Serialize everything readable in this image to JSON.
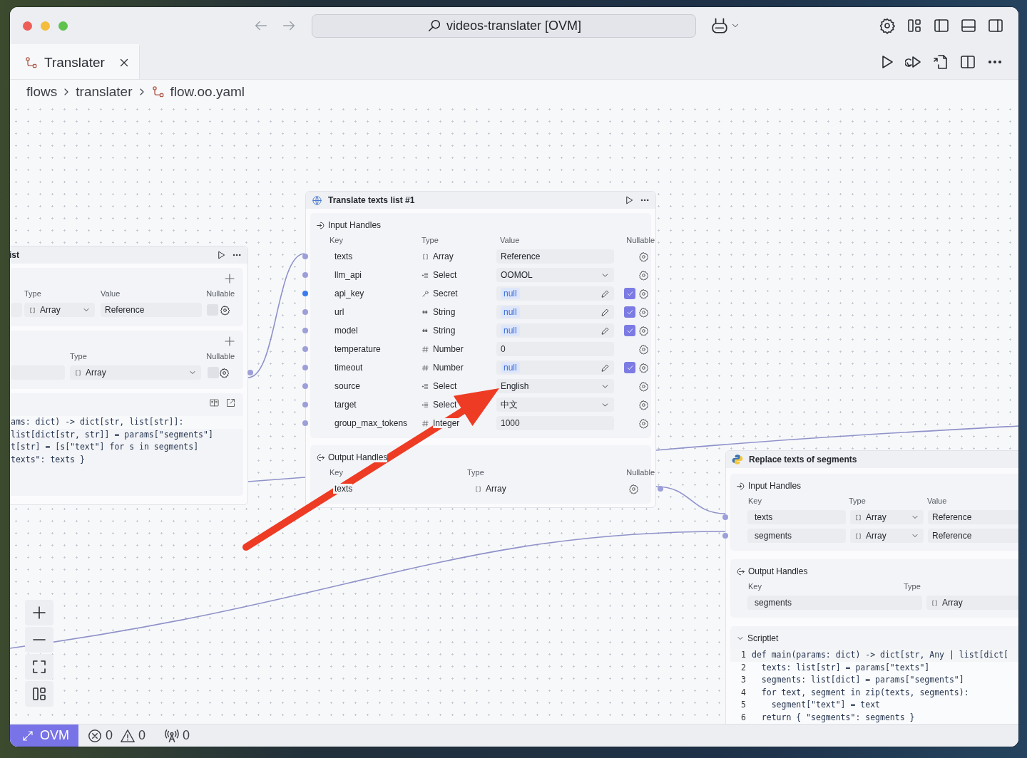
{
  "titlebar": {
    "search": "videos-translater [OVM]"
  },
  "tabs": [
    {
      "label": "Translater",
      "selected": true
    }
  ],
  "breadcrumb": [
    "flows",
    "translater",
    "flow.oo.yaml"
  ],
  "left_node": {
    "title": "ist",
    "input_columns": [
      "Type",
      "Value",
      "Nullable"
    ],
    "inputs": [
      {
        "type": "Array",
        "value": "Reference",
        "nullable": false
      }
    ],
    "output_columns": [
      "Type",
      "Nullable"
    ],
    "outputs": [
      {
        "type": "Array",
        "nullable": false
      }
    ],
    "code_lines": [
      "ams: dict) -> dict[str, list[str]]:",
      "list[dict[str, str]] = params[\"segments\"]",
      "t[str] = [s[\"text\"] for s in segments]",
      "texts\": texts }"
    ]
  },
  "middle_node": {
    "title": "Translate texts list #1",
    "inputs_title": "Input Handles",
    "input_columns": [
      "Key",
      "Type",
      "Value",
      "Nullable"
    ],
    "inputs": [
      {
        "key": "texts",
        "type": {
          "kind": "array",
          "label": "Array"
        },
        "kind": "text",
        "value": "Reference",
        "nullable": false,
        "handle_active": false
      },
      {
        "key": "llm_api",
        "type": {
          "kind": "select",
          "label": "Select"
        },
        "kind": "select",
        "value": "OOMOL",
        "nullable": false,
        "handle_active": false
      },
      {
        "key": "api_key",
        "type": {
          "kind": "secret",
          "label": "Secret"
        },
        "kind": "null",
        "value": "null",
        "nullable": true,
        "handle_active": true
      },
      {
        "key": "url",
        "type": {
          "kind": "string",
          "label": "String"
        },
        "kind": "null",
        "value": "null",
        "nullable": true,
        "handle_active": false
      },
      {
        "key": "model",
        "type": {
          "kind": "string",
          "label": "String"
        },
        "kind": "null",
        "value": "null",
        "nullable": true,
        "handle_active": false
      },
      {
        "key": "temperature",
        "type": {
          "kind": "number",
          "label": "Number"
        },
        "kind": "text",
        "value": "0",
        "nullable": false,
        "handle_active": false
      },
      {
        "key": "timeout",
        "type": {
          "kind": "number",
          "label": "Number"
        },
        "kind": "null",
        "value": "null",
        "nullable": true,
        "handle_active": false
      },
      {
        "key": "source",
        "type": {
          "kind": "select",
          "label": "Select"
        },
        "kind": "select",
        "value": "English",
        "nullable": false,
        "handle_active": false
      },
      {
        "key": "target",
        "type": {
          "kind": "select",
          "label": "Select"
        },
        "kind": "select",
        "value": "中文",
        "nullable": false,
        "handle_active": false
      },
      {
        "key": "group_max_tokens",
        "type": {
          "kind": "number",
          "label": "Integer"
        },
        "kind": "text",
        "value": "1000",
        "nullable": false,
        "handle_active": false
      }
    ],
    "outputs_title": "Output Handles",
    "output_columns": [
      "Key",
      "Type",
      "Nullable"
    ],
    "outputs": [
      {
        "key": "texts",
        "type": {
          "kind": "array",
          "label": "Array"
        },
        "nullable": false
      }
    ]
  },
  "right_node": {
    "title": "Replace texts of segments",
    "inputs_title": "Input Handles",
    "input_columns": [
      "Key",
      "Type",
      "Value"
    ],
    "inputs": [
      {
        "key": "texts",
        "type": "Array",
        "value": "Reference"
      },
      {
        "key": "segments",
        "type": "Array",
        "value": "Reference"
      }
    ],
    "outputs_title": "Output Handles",
    "output_columns": [
      "Key",
      "Type"
    ],
    "outputs": [
      {
        "key": "segments",
        "type": "Array"
      }
    ],
    "scriptlet": {
      "title": "Scriptlet",
      "expanded": true,
      "lines": [
        {
          "number": "1",
          "code": "def main(params: dict) -> dict[str, Any | list[dict["
        },
        {
          "number": "2",
          "code": "  texts: list[str] = params[\"texts\"]"
        },
        {
          "number": "3",
          "code": "  segments: list[dict] = params[\"segments\"]"
        },
        {
          "number": "4",
          "code": "  for text, segment in zip(texts, segments):"
        },
        {
          "number": "5",
          "code": "    segment[\"text\"] = text"
        },
        {
          "number": "6",
          "code": "  return { \"segments\": segments }"
        }
      ]
    }
  },
  "status_bar": {
    "remote": "OVM",
    "errors": "0",
    "warnings": "0",
    "ports": "0"
  }
}
